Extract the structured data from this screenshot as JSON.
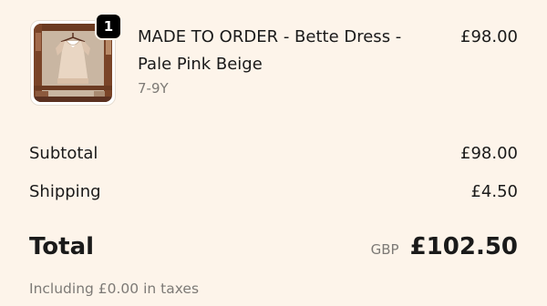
{
  "line_item": {
    "quantity": "1",
    "title": "MADE TO ORDER - Bette Dress - Pale Pink Beige",
    "variant": "7-9Y",
    "price": "£98.00",
    "image_icon": "product-photo-dress-on-shelf"
  },
  "summary": {
    "subtotal_label": "Subtotal",
    "subtotal_value": "£98.00",
    "shipping_label": "Shipping",
    "shipping_value": "£4.50",
    "total_label": "Total",
    "total_currency": "GBP",
    "total_value": "£102.50",
    "taxes_note": "Including £0.00 in taxes"
  },
  "colors": {
    "background": "#fdf4ea",
    "text": "#1a1a1a",
    "muted": "#7d7a76",
    "badge": "#000000"
  }
}
